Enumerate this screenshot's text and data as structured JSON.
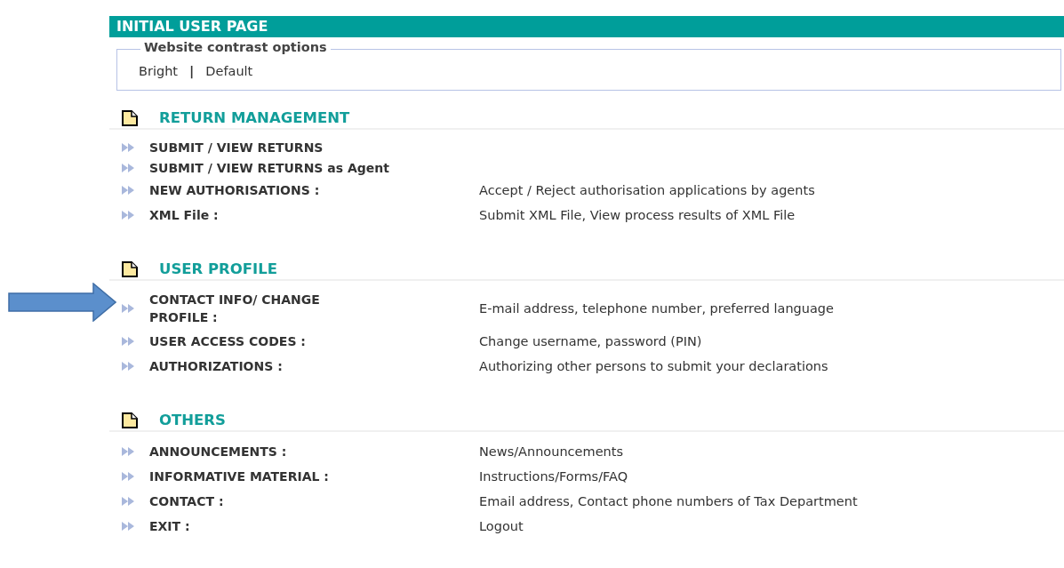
{
  "page_title": "INITIAL USER PAGE",
  "contrast_options": {
    "legend": "Website contrast options",
    "options": [
      "Bright",
      "Default"
    ],
    "separator": "|"
  },
  "sections": [
    {
      "heading": "RETURN MANAGEMENT",
      "items": [
        {
          "label": "SUBMIT / VIEW RETURNS"
        },
        {
          "label": "SUBMIT / VIEW RETURNS as Agent"
        },
        {
          "label": "NEW AUTHORISATIONS :",
          "description": "Accept / Reject authorisation applications by agents"
        },
        {
          "label": "XML File :",
          "description": "Submit XML File, View process results of XML File"
        }
      ]
    },
    {
      "heading": "USER PROFILE",
      "items": [
        {
          "label": "CONTACT INFO/ CHANGE PROFILE :",
          "description": "E-mail address, telephone number, preferred language",
          "highlighted": true
        },
        {
          "label": "USER ACCESS CODES :",
          "description": "Change username, password (PIN)"
        },
        {
          "label": "AUTHORIZATIONS :",
          "description": "Authorizing other persons to submit your declarations"
        }
      ]
    },
    {
      "heading": "OTHERS",
      "items": [
        {
          "label": "ANNOUNCEMENTS :",
          "description": "News/Announcements"
        },
        {
          "label": "INFORMATIVE MATERIAL :",
          "description": "Instructions/Forms/FAQ"
        },
        {
          "label": "CONTACT :",
          "description": "Email address, Contact phone numbers of Tax Department"
        },
        {
          "label": "EXIT :",
          "description": "Logout"
        }
      ]
    }
  ]
}
